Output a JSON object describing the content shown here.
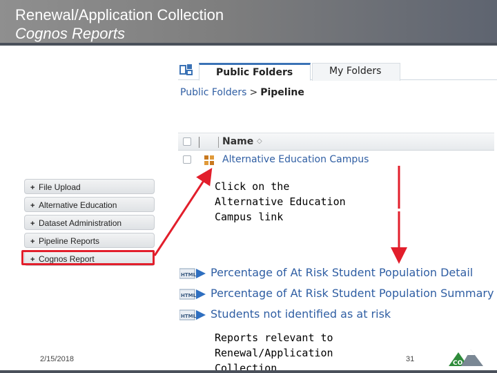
{
  "slide": {
    "title_line1": "Renewal/Application Collection",
    "title_line2": "Cognos Reports",
    "date": "2/15/2018",
    "page_number": "31",
    "logo_text": "CO"
  },
  "cognos": {
    "tabs": [
      {
        "label": "Public Folders",
        "active": true
      },
      {
        "label": "My Folders",
        "active": false
      }
    ],
    "breadcrumb": {
      "root": "Public Folders",
      "separator": ">",
      "current": "Pipeline"
    },
    "column_name": "Name",
    "folder_link": "Alternative Education Campus",
    "reports": [
      {
        "icon": "html-report-icon",
        "label": "Percentage of At Risk Student Population Detail"
      },
      {
        "icon": "html-report-icon",
        "label": "Percentage of At Risk Student Population Summary"
      },
      {
        "icon": "html-report-icon",
        "label": "Students not identified as at risk"
      }
    ]
  },
  "nav": {
    "items": [
      {
        "label": "File Upload"
      },
      {
        "label": "Alternative Education"
      },
      {
        "label": "Dataset Administration"
      },
      {
        "label": "Pipeline Reports"
      },
      {
        "label": "Cognos Report",
        "highlighted": true
      }
    ]
  },
  "callouts": {
    "click_instruction": "Click on the Alternative Education Campus link",
    "reports_note": "Reports relevant to Renewal/Application Collection"
  },
  "colors": {
    "link": "#2f5ea3",
    "highlight": "#e21e2b",
    "logo_green": "#2e8b3a"
  }
}
